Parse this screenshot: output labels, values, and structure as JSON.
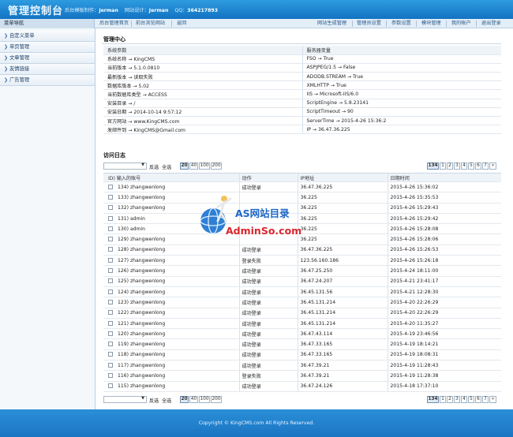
{
  "header": {
    "app_title": "管理控制台",
    "credits": [
      {
        "label": "后台模板制作：",
        "value": "Jerman"
      },
      {
        "label": "网站设计：",
        "value": "Jerman"
      },
      {
        "label": "QQ：",
        "value": "364217893"
      }
    ]
  },
  "topnav": {
    "menu_heading": "菜单导航",
    "left_links": [
      "后台管理首页",
      "前台浏览网站",
      "返回"
    ],
    "right_links": [
      "网站生成管理",
      "管理员设置",
      "参数设置",
      "模块管理",
      "我的帐户",
      "退出登录"
    ]
  },
  "sidebar": {
    "items": [
      "自定义菜单",
      "单页管理",
      "文章管理",
      "友情链接",
      "广告管理"
    ]
  },
  "manage_center": {
    "title": "管理中心",
    "col_left": "系统参数",
    "col_right": "服务器变量",
    "rows": [
      [
        "系统名称 → KingCMS",
        "FSO → True"
      ],
      [
        "当前版本 → 5.1.0.0810",
        "ASPJPEG/1.5 → False"
      ],
      [
        "最新版本 → 读取失败",
        "ADODB.STREAM → True"
      ],
      [
        "数据库版本 → 5.02",
        "XMLHTTP → True"
      ],
      [
        "当前数据库类型 → ACCESS",
        "IIS → Microsoft-IIS/6.0"
      ],
      [
        "安装目录 → /",
        "ScriptEngine → 5.8.23141"
      ],
      [
        "安装日期 → 2014-10-14 9:57:12",
        "ScriptTimeout → 90"
      ],
      [
        "官方网站 → www.KingCMS.com",
        "ServerTime → 2015-4-26 15:36:2"
      ],
      [
        "发邮件到 → KingCMS@Gmail.com",
        "IP → 36.47.36.225"
      ]
    ]
  },
  "access_log": {
    "title": "访问日志",
    "toolbar": {
      "invert": "反选",
      "select_all": "全选",
      "page_sizes": [
        "20",
        "40",
        "100",
        "200"
      ],
      "pages": [
        "134",
        "1",
        "2",
        "3",
        "4",
        "5",
        "6",
        "7",
        "»"
      ]
    },
    "columns": [
      "ID) 输入的账号",
      "动作",
      "IP地址",
      "日期时间"
    ],
    "rows": [
      [
        "134) zhangwenlong",
        "成功登录",
        "36.47.36.225",
        "2015-4-26 15:36:02"
      ],
      [
        "133) zhangwenlong",
        "",
        "36.225",
        "2015-4-26 15:35:53"
      ],
      [
        "132) zhangwenlong",
        "",
        "36.225",
        "2015-4-26 15:29:43"
      ],
      [
        "131) admin",
        "",
        "36.225",
        "2015-4-26 15:29:42"
      ],
      [
        "130) admin",
        "",
        "36.225",
        "2015-4-26 15:28:08"
      ],
      [
        "129) zhangwenlong",
        "",
        "36.225",
        "2015-4-26 15:28:06"
      ],
      [
        "128) zhangwenlong",
        "成功登录",
        "36.47.36.225",
        "2015-4-26 15:26:53"
      ],
      [
        "127) zhangwenlong",
        "登录失败",
        "123.56.160.186",
        "2015-4-26 15:26:18"
      ],
      [
        "126) zhangwenlong",
        "成功登录",
        "36.47.25.250",
        "2015-4-24 18:11:00"
      ],
      [
        "125) zhangwenlong",
        "成功登录",
        "36.47.24.207",
        "2015-4-21 23:41:17"
      ],
      [
        "124) zhangwenlong",
        "成功登录",
        "36.45.131.56",
        "2015-4-21 12:28:30"
      ],
      [
        "123) zhangwenlong",
        "成功登录",
        "36.45.131.214",
        "2015-4-20 22:26:29"
      ],
      [
        "122) zhangwenlong",
        "成功登录",
        "36.45.131.214",
        "2015-4-20 22:26:29"
      ],
      [
        "121) zhangwenlong",
        "成功登录",
        "36.45.131.214",
        "2015-4-20 11:35:27"
      ],
      [
        "120) zhangwenlong",
        "成功登录",
        "36.47.43.114",
        "2015-4-19 23:46:56"
      ],
      [
        "119) zhangwenlong",
        "成功登录",
        "36.47.33.165",
        "2015-4-19 18:14:21"
      ],
      [
        "118) zhangwenlong",
        "成功登录",
        "36.47.33.165",
        "2015-4-19 18:08:31"
      ],
      [
        "117) zhangwenlong",
        "成功登录",
        "36.47.39.21",
        "2015-4-19 11:28:43"
      ],
      [
        "116) zhangwenlong",
        "登录失败",
        "36.47.39.21",
        "2015-4-19 11:28:38"
      ],
      [
        "115) zhangwenlong",
        "成功登录",
        "36.47.24.126",
        "2015-4-18 17:37:10"
      ]
    ]
  },
  "watermark": {
    "line1": "AS网站目录",
    "line2": "AdminSo.com"
  },
  "footer": {
    "copyright": "Copyright © KingCMS.com All Rights Reserved."
  }
}
